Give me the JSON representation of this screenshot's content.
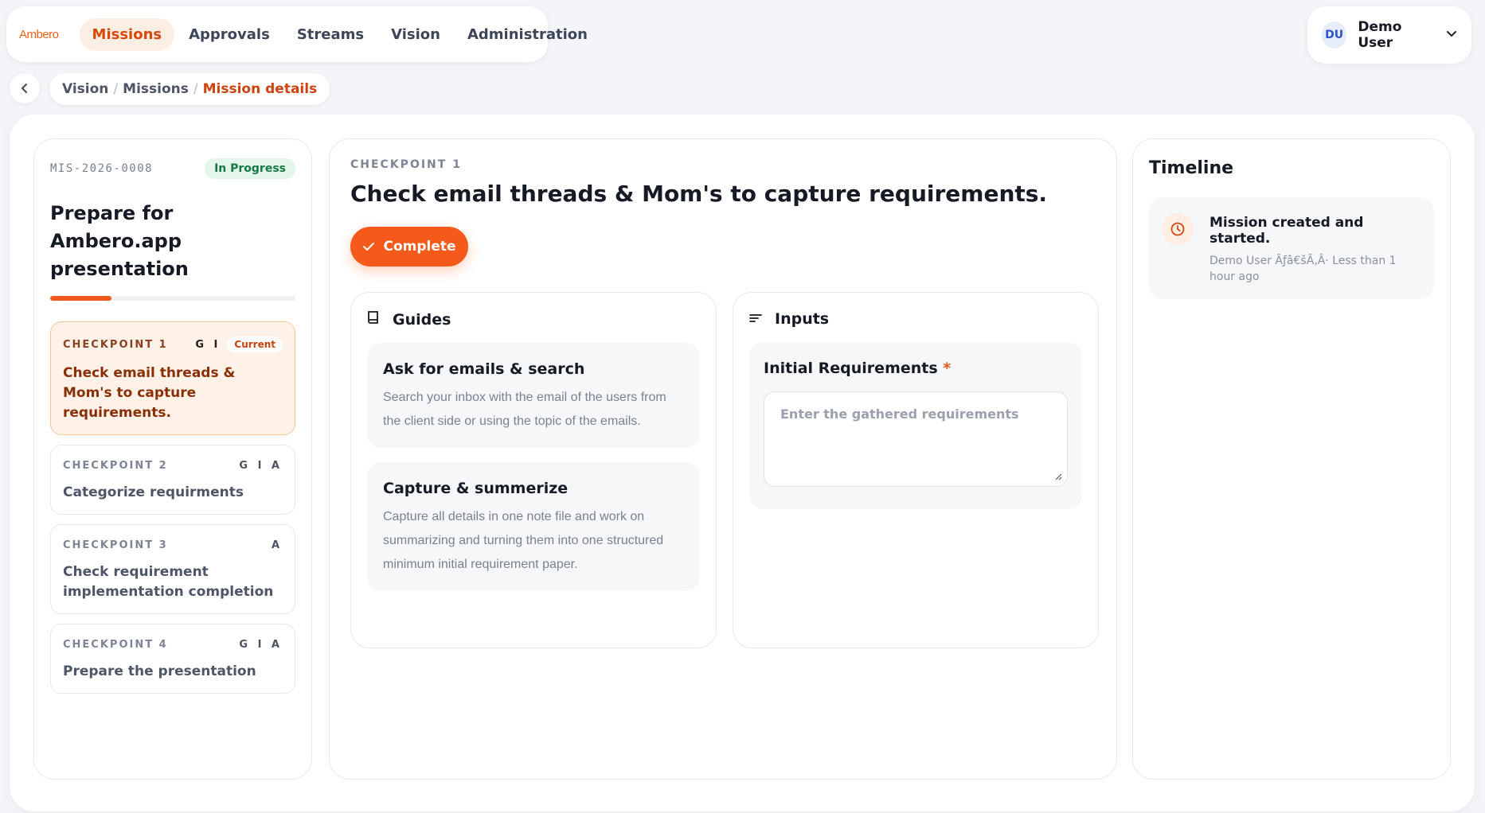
{
  "nav": {
    "logo": "Ambero",
    "tabs": [
      {
        "label": "Missions",
        "active": true
      },
      {
        "label": "Approvals",
        "active": false
      },
      {
        "label": "Streams",
        "active": false
      },
      {
        "label": "Vision",
        "active": false
      },
      {
        "label": "Administration",
        "active": false
      }
    ]
  },
  "user": {
    "initials": "DU",
    "name": "Demo User"
  },
  "breadcrumb": {
    "items": [
      "Vision",
      "Missions"
    ],
    "current": "Mission details",
    "separator": "/"
  },
  "mission": {
    "id": "MIS-2026-0008",
    "status": "In Progress",
    "title": "Prepare for Ambero.app presentation",
    "progress_percent": 25,
    "checkpoints": [
      {
        "label": "CHECKPOINT 1",
        "tags": "G I",
        "badge": "Current",
        "text": "Check email threads & Mom's to capture requirements.",
        "current": true
      },
      {
        "label": "CHECKPOINT 2",
        "tags": "G I A",
        "text": "Categorize requirments",
        "current": false
      },
      {
        "label": "CHECKPOINT 3",
        "tags": "A",
        "text": "Check requirement implementation completion",
        "current": false
      },
      {
        "label": "CHECKPOINT 4",
        "tags": "G I A",
        "text": "Prepare the presentation",
        "current": false
      }
    ]
  },
  "checkpoint_detail": {
    "label": "CHECKPOINT 1",
    "title": "Check email threads & Mom's to capture requirements.",
    "complete_label": "Complete",
    "guides_title": "Guides",
    "guides": [
      {
        "title": "Ask for emails & search",
        "desc": "Search your inbox with the email of the users from the client side or using the topic of the emails."
      },
      {
        "title": "Capture & summerize",
        "desc": "Capture all details in one note file and work on summarizing and turning them into one structured minimum initial requirement paper."
      }
    ],
    "inputs_title": "Inputs",
    "input": {
      "label": "Initial Requirements",
      "required_mark": "*",
      "placeholder": "Enter the gathered requirements"
    }
  },
  "timeline": {
    "title": "Timeline",
    "items": [
      {
        "text": "Mission created and started.",
        "meta": "Demo User Ãƒâ€šÃ‚Â· Less than 1 hour ago"
      }
    ]
  },
  "colors": {
    "accent": "#f55a1a",
    "accent_text": "#cf4310",
    "status_green": "#137a43"
  }
}
